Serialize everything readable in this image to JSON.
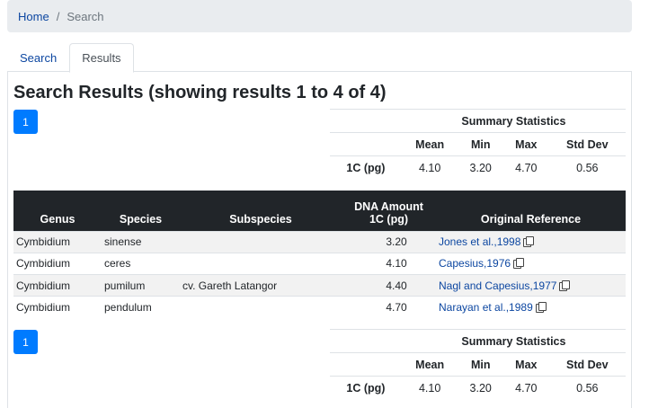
{
  "breadcrumb": {
    "home": "Home",
    "separator": "/",
    "current": "Search"
  },
  "tabs": [
    {
      "label": "Search"
    },
    {
      "label": "Results"
    }
  ],
  "results_heading": "Search Results (showing results 1 to 4 of 4)",
  "pagination": {
    "page": "1"
  },
  "summary": {
    "title": "Summary Statistics",
    "headers": [
      "Mean",
      "Min",
      "Max",
      "Std Dev"
    ],
    "row_label": "1C (pg)",
    "values": [
      "4.10",
      "3.20",
      "4.70",
      "0.56"
    ]
  },
  "table": {
    "headers": {
      "genus": "Genus",
      "species": "Species",
      "subspecies": "Subspecies",
      "dna_line1": "DNA Amount",
      "dna_line2": "1C (pg)",
      "reference": "Original Reference"
    },
    "rows": [
      {
        "genus": "Cymbidium",
        "species": "sinense",
        "subspecies": "",
        "dna": "3.20",
        "reference": "Jones et al.,1998"
      },
      {
        "genus": "Cymbidium",
        "species": "ceres",
        "subspecies": "",
        "dna": "4.10",
        "reference": "Capesius,1976"
      },
      {
        "genus": "Cymbidium",
        "species": "pumilum",
        "subspecies": "cv. Gareth Latangor",
        "dna": "4.40",
        "reference": "Nagl and Capesius,1977"
      },
      {
        "genus": "Cymbidium",
        "species": "pendulum",
        "subspecies": "",
        "dna": "4.70",
        "reference": "Narayan et al.,1989"
      }
    ]
  },
  "colors": {
    "link": "#0d47a1",
    "page_button": "#007bff",
    "table_header": "#212529",
    "breadcrumb_bg": "#e9ecef"
  },
  "icons": {
    "copy": "copy-icon"
  }
}
